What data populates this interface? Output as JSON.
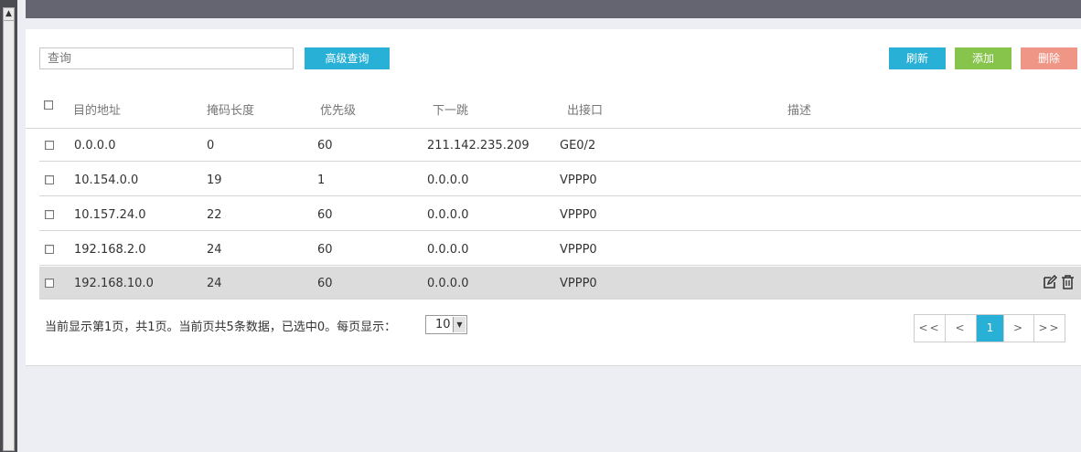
{
  "toolbar": {
    "search_placeholder": "查询",
    "advanced_search_label": "高级查询",
    "refresh_label": "刷新",
    "add_label": "添加",
    "delete_label": "删除"
  },
  "table": {
    "columns": [
      "目的地址",
      "掩码长度",
      "优先级",
      "下一跳",
      "出接口",
      "描述"
    ],
    "rows": [
      {
        "dest": "0.0.0.0",
        "mask": "0",
        "priority": "60",
        "next_hop": "211.142.235.209",
        "iface": "GE0/2",
        "desc": ""
      },
      {
        "dest": "10.154.0.0",
        "mask": "19",
        "priority": "1",
        "next_hop": "0.0.0.0",
        "iface": "VPPP0",
        "desc": ""
      },
      {
        "dest": "10.157.24.0",
        "mask": "22",
        "priority": "60",
        "next_hop": "0.0.0.0",
        "iface": "VPPP0",
        "desc": ""
      },
      {
        "dest": "192.168.2.0",
        "mask": "24",
        "priority": "60",
        "next_hop": "0.0.0.0",
        "iface": "VPPP0",
        "desc": ""
      },
      {
        "dest": "192.168.10.0",
        "mask": "24",
        "priority": "60",
        "next_hop": "0.0.0.0",
        "iface": "VPPP0",
        "desc": ""
      }
    ],
    "row_icons": [
      "edit-icon",
      "trash-icon"
    ]
  },
  "footer": {
    "status_text": "当前显示第1页，共1页。当前页共5条数据，已选中0。每页显示：",
    "page_size": "10"
  },
  "pagination": {
    "first": "<<",
    "prev": "<",
    "current": "1",
    "next": ">",
    "last": ">>"
  },
  "colors": {
    "accent": "#29b0d6",
    "add": "#87c44c",
    "delete": "#f09687",
    "topbar": "#646570"
  }
}
